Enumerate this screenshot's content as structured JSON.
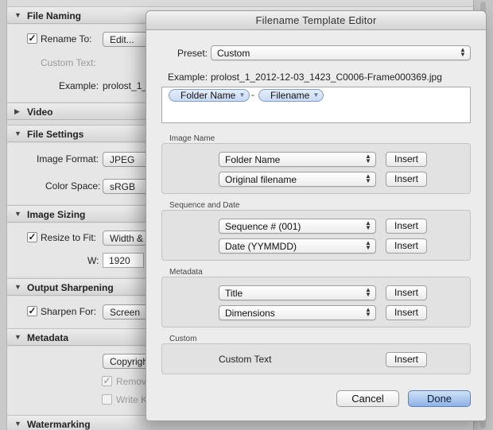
{
  "dialog": {
    "title": "Filename Template Editor",
    "preset_label": "Preset:",
    "preset_value": "Custom",
    "example_label": "Example:",
    "example_value": "prolost_1_2012-12-03_1423_C0006-Frame000369.jpg",
    "tokens": [
      "Folder Name",
      "Filename"
    ],
    "token_separator": "-",
    "image_name": {
      "title": "Image Name",
      "rows": [
        {
          "value": "Folder Name",
          "button": "Insert"
        },
        {
          "value": "Original filename",
          "button": "Insert"
        }
      ]
    },
    "sequence": {
      "title": "Sequence and Date",
      "rows": [
        {
          "value": "Sequence # (001)",
          "button": "Insert"
        },
        {
          "value": "Date (YYMMDD)",
          "button": "Insert"
        }
      ]
    },
    "metadata": {
      "title": "Metadata",
      "rows": [
        {
          "value": "Title",
          "button": "Insert"
        },
        {
          "value": "Dimensions",
          "button": "Insert"
        }
      ]
    },
    "custom": {
      "title": "Custom",
      "label": "Custom Text",
      "button": "Insert"
    },
    "cancel": "Cancel",
    "done": "Done"
  },
  "panel": {
    "file_naming": {
      "header": "File Naming",
      "rename_to": "Rename To:",
      "edit_value": "Edit...",
      "custom_text": "Custom Text:",
      "example_label": "Example:",
      "example_value": "prolost_1_"
    },
    "video": {
      "header": "Video"
    },
    "file_settings": {
      "header": "File Settings",
      "image_format_label": "Image Format:",
      "image_format_value": "JPEG",
      "color_space_label": "Color Space:",
      "color_space_value": "sRGB"
    },
    "image_sizing": {
      "header": "Image Sizing",
      "resize_label": "Resize to Fit:",
      "resize_value": "Width &",
      "w_label": "W:",
      "w_value": "1920"
    },
    "output_sharpening": {
      "header": "Output Sharpening",
      "sharpen_label": "Sharpen For:",
      "sharpen_value": "Screen"
    },
    "metadata": {
      "header": "Metadata",
      "copyright_value": "Copyrigh",
      "remove_label": "Remov",
      "write_label": "Write K"
    },
    "watermarking": {
      "header": "Watermarking"
    }
  }
}
